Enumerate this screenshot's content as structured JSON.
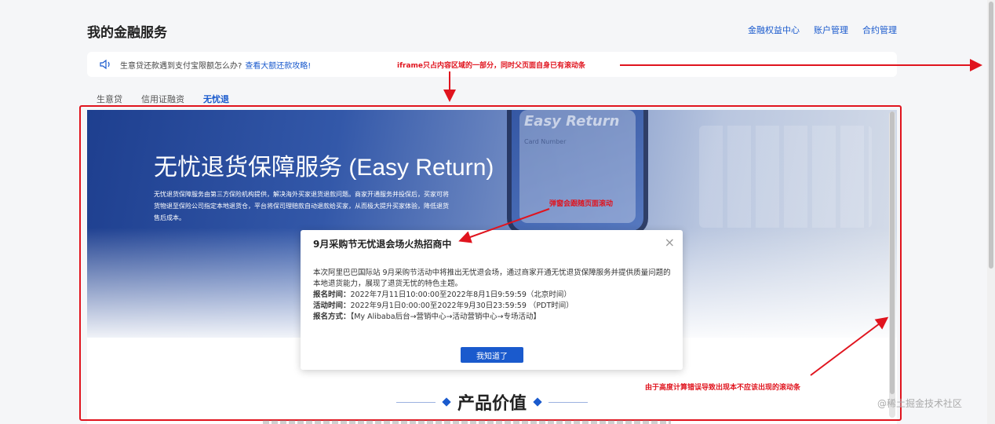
{
  "header": {
    "title": "我的金融服务",
    "links": [
      "金融权益中心",
      "账户管理",
      "合约管理"
    ]
  },
  "notice": {
    "text": "生意贷还款遇到支付宝限额怎么办?",
    "link": "查看大额还款攻略!"
  },
  "tabs": [
    {
      "label": "生意贷",
      "active": false
    },
    {
      "label": "信用证融资",
      "active": false
    },
    {
      "label": "无忧退",
      "active": true
    }
  ],
  "hero": {
    "title": "无忧退货保障服务 (Easy Return)",
    "phone_screen_title": "Easy Return",
    "phone_screen_sub": "Card Number",
    "description": "无忧退货保障服务由第三方保险机构提供，解决海外买家退货退款问题。商家开通服务并投保后，买家可将货物退至保险公司指定本地退货仓，平台将保司理赔款自动退款给买家，从而极大提升买家体验，降低退货售后成本。"
  },
  "section": {
    "title": "产品价值"
  },
  "modal": {
    "title": "9月采购节无忧退会场火热招商中",
    "paragraph": "本次阿里巴巴国际站 9月采购节活动中将推出无忧退会场，通过商家开通无忧退货保障服务并提供质量问题的本地退货能力，展现了退货无忧的特色主题。",
    "rows": [
      {
        "key": "报名时间：",
        "value": "2022年7月11日10:00:00至2022年8月1日9:59:59（北京时间）"
      },
      {
        "key": "活动时间：",
        "value": "2022年9月1日0:00:00至2022年9月30日23:59:59 （PDT时间）"
      },
      {
        "key": "报名方式：",
        "value": "【My Alibaba后台→营销中心→活动营销中心→专场活动】"
      }
    ],
    "button": "我知道了",
    "close": "×"
  },
  "annotations": {
    "top": "iframe只占内容区域的一部分，同时父页面自身已有滚动条",
    "modal": "弹窗会跟随页面滚动",
    "scroll": "由于高度计算错误导致出现本不应该出现的滚动条"
  },
  "colors": {
    "accent": "#1a5acd",
    "annotation": "#e0141e"
  },
  "watermark": "@稀土掘金技术社区"
}
